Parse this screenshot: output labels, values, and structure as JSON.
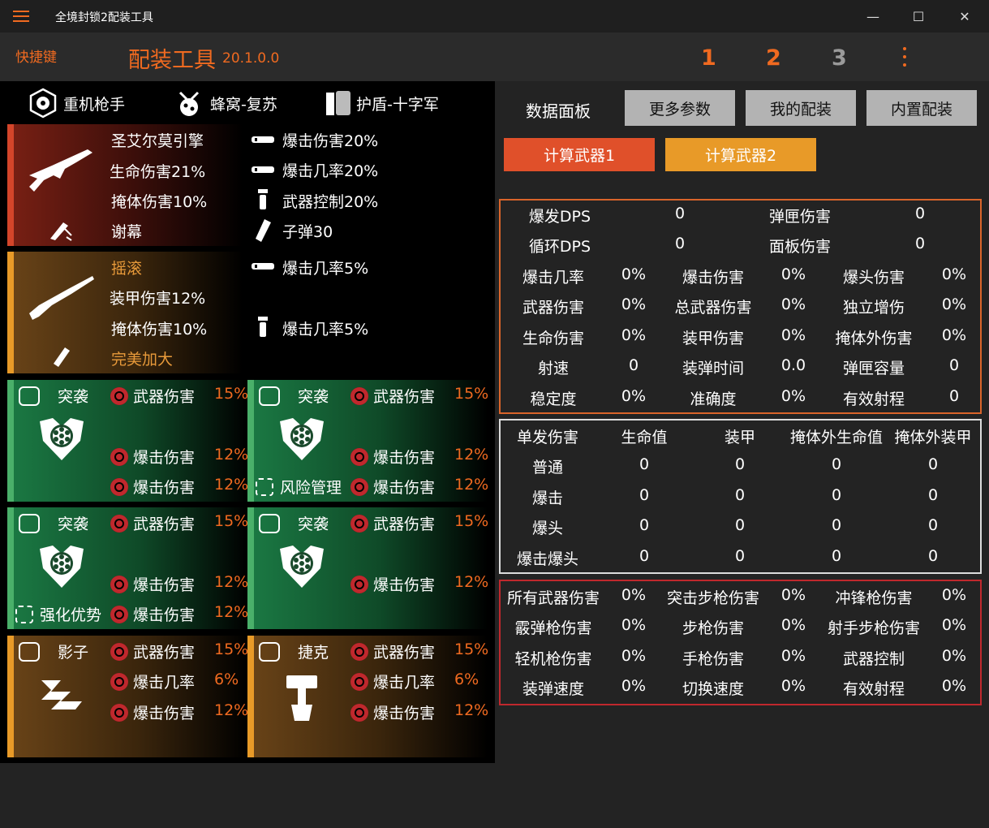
{
  "titlebar": {
    "title": "全境封锁2配装工具",
    "minimize": "—",
    "maximize": "☐",
    "close": "✕"
  },
  "header": {
    "shortcut": "快捷键",
    "app_title": "配装工具",
    "version": "20.1.0.0",
    "pages": [
      "1",
      "2",
      "3"
    ]
  },
  "colors": {
    "accent": "#f06a20",
    "red_button": "#e0502a",
    "orange_button": "#e89a28",
    "exotic_gold": "#e89a3a",
    "gear_green": "#1b6b3a"
  },
  "build_header": {
    "specialization": "重机枪手",
    "set1": "蜂窝-复苏",
    "set2": "护盾-十字军"
  },
  "weapon1": {
    "name": "圣艾尔莫引擎",
    "stat1": "生命伤害21%",
    "stat2": "掩体伤害10%",
    "talent": "谢幕",
    "mods": [
      "爆击伤害20%",
      "爆击几率20%",
      "武器控制20%",
      "子弹30"
    ]
  },
  "weapon2": {
    "name": "摇滚",
    "stat1": "装甲伤害12%",
    "stat2": "掩体伤害10%",
    "talent": "完美加大",
    "mods": [
      "爆击几率5%",
      "爆击几率5%"
    ]
  },
  "gear": [
    {
      "brand": "突袭",
      "rows": [
        {
          "label": "武器伤害",
          "value": "15%"
        },
        {
          "label": "爆击伤害",
          "value": "12%"
        },
        {
          "label": "爆击伤害",
          "value": "12%"
        }
      ],
      "talent": ""
    },
    {
      "brand": "突袭",
      "rows": [
        {
          "label": "武器伤害",
          "value": "15%"
        },
        {
          "label": "爆击伤害",
          "value": "12%"
        },
        {
          "label": "爆击伤害",
          "value": "12%"
        }
      ],
      "talent": "风险管理"
    },
    {
      "brand": "突袭",
      "rows": [
        {
          "label": "武器伤害",
          "value": "15%"
        },
        {
          "label": "爆击伤害",
          "value": "12%"
        },
        {
          "label": "爆击伤害",
          "value": "12%"
        }
      ],
      "talent": "强化优势"
    },
    {
      "brand": "突袭",
      "rows": [
        {
          "label": "武器伤害",
          "value": "15%"
        },
        {
          "label": "爆击伤害",
          "value": "12%"
        }
      ],
      "talent": ""
    },
    {
      "brand": "影子",
      "rows": [
        {
          "label": "武器伤害",
          "value": "15%"
        },
        {
          "label": "爆击几率",
          "value": "6%"
        },
        {
          "label": "爆击伤害",
          "value": "12%"
        }
      ],
      "talent": ""
    },
    {
      "brand": "捷克",
      "rows": [
        {
          "label": "武器伤害",
          "value": "15%"
        },
        {
          "label": "爆击几率",
          "value": "6%"
        },
        {
          "label": "爆击伤害",
          "value": "12%"
        }
      ],
      "talent": ""
    }
  ],
  "right": {
    "panel_label": "数据面板",
    "buttons": [
      "更多参数",
      "我的配装",
      "内置配装"
    ],
    "calc1": "计算武器1",
    "calc2": "计算武器2",
    "stats_top": [
      [
        "爆发DPS",
        "0",
        "弹匣伤害",
        "0"
      ],
      [
        "循环DPS",
        "0",
        "面板伤害",
        "0"
      ]
    ],
    "stats_grid": [
      [
        "爆击几率",
        "0%",
        "爆击伤害",
        "0%",
        "爆头伤害",
        "0%"
      ],
      [
        "武器伤害",
        "0%",
        "总武器伤害",
        "0%",
        "独立增伤",
        "0%"
      ],
      [
        "生命伤害",
        "0%",
        "装甲伤害",
        "0%",
        "掩体外伤害",
        "0%"
      ],
      [
        "射速",
        "0",
        "装弹时间",
        "0.0",
        "弹匣容量",
        "0"
      ],
      [
        "稳定度",
        "0%",
        "准确度",
        "0%",
        "有效射程",
        "0"
      ]
    ],
    "damage_table": {
      "headers": [
        "单发伤害",
        "生命值",
        "装甲",
        "掩体外生命值",
        "掩体外装甲"
      ],
      "rows": [
        [
          "普通",
          "0",
          "0",
          "0",
          "0"
        ],
        [
          "爆击",
          "0",
          "0",
          "0",
          "0"
        ],
        [
          "爆头",
          "0",
          "0",
          "0",
          "0"
        ],
        [
          "爆击爆头",
          "0",
          "0",
          "0",
          "0"
        ]
      ]
    },
    "bonus_grid": [
      [
        "所有武器伤害",
        "0%",
        "突击步枪伤害",
        "0%",
        "冲锋枪伤害",
        "0%"
      ],
      [
        "霰弹枪伤害",
        "0%",
        "步枪伤害",
        "0%",
        "射手步枪伤害",
        "0%"
      ],
      [
        "轻机枪伤害",
        "0%",
        "手枪伤害",
        "0%",
        "武器控制",
        "0%"
      ],
      [
        "装弹速度",
        "0%",
        "切换速度",
        "0%",
        "有效射程",
        "0%"
      ]
    ]
  }
}
